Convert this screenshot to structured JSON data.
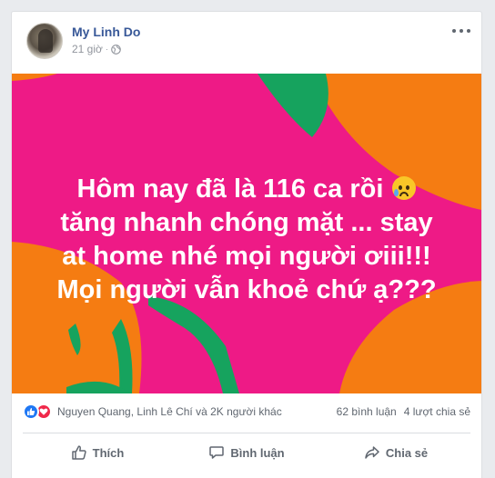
{
  "post": {
    "author": "My Linh Do",
    "time": "21 giờ",
    "separator": "·",
    "text_lines": [
      "Hôm nay đã là 116 ca rồi",
      "tăng nhanh chóng mặt ... stay",
      "at home nhé mọi người ơiii!!!",
      "Mọi người vẫn khoẻ chứ ạ???"
    ],
    "background_colors": {
      "pink": "#ee1a86",
      "orange": "#f57c12",
      "green": "#16a35e"
    }
  },
  "reactions": {
    "names": "Nguyen Quang, Linh Lê Chí và 2K người khác",
    "comments": "62 bình luận",
    "shares": "4 lượt chia sẻ"
  },
  "actions": {
    "like": "Thích",
    "comment": "Bình luận",
    "share": "Chia sẻ"
  }
}
